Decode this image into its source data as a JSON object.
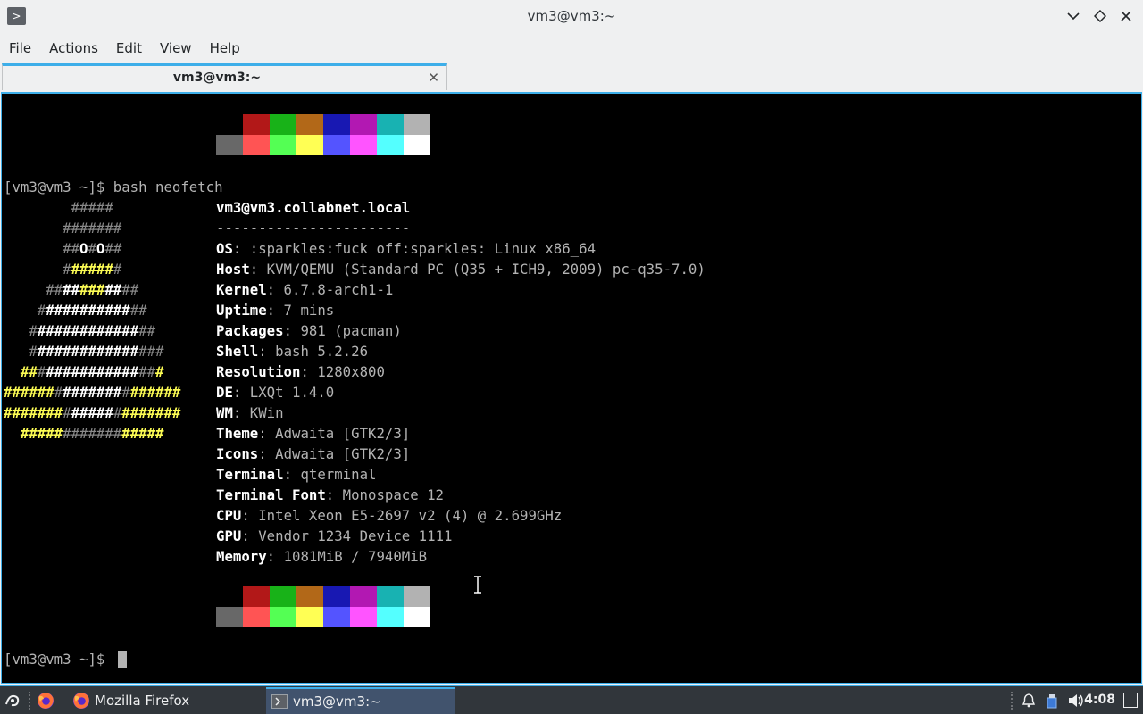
{
  "window": {
    "title": "vm3@vm3:~",
    "app_icon_glyph": ">"
  },
  "menubar": [
    "File",
    "Actions",
    "Edit",
    "View",
    "Help"
  ],
  "tab": {
    "label": "vm3@vm3:~",
    "close_glyph": "✕"
  },
  "terminal": {
    "command_line": "[vm3@vm3 ~]$ bash neofetch",
    "prompt_line": "[vm3@vm3 ~]$ ",
    "user_host": "vm3@vm3.collabnet.local",
    "separator": "-----------------------",
    "info": [
      {
        "key": "OS",
        "value": ": :sparkles:fuck off:sparkles: Linux x86_64"
      },
      {
        "key": "Host",
        "value": ": KVM/QEMU (Standard PC (Q35 + ICH9, 2009) pc-q35-7.0)"
      },
      {
        "key": "Kernel",
        "value": ": 6.7.8-arch1-1"
      },
      {
        "key": "Uptime",
        "value": ": 7 mins"
      },
      {
        "key": "Packages",
        "value": ": 981 (pacman)"
      },
      {
        "key": "Shell",
        "value": ": bash 5.2.26"
      },
      {
        "key": "Resolution",
        "value": ": 1280x800"
      },
      {
        "key": "DE",
        "value": ": LXQt 1.4.0"
      },
      {
        "key": "WM",
        "value": ": KWin"
      },
      {
        "key": "Theme",
        "value": ": Adwaita [GTK2/3]"
      },
      {
        "key": "Icons",
        "value": ": Adwaita [GTK2/3]"
      },
      {
        "key": "Terminal",
        "value": ": qterminal"
      },
      {
        "key": "Terminal Font",
        "value": ": Monospace 12"
      },
      {
        "key": "CPU",
        "value": ": Intel Xeon E5-2697 v2 (4) @ 2.699GHz"
      },
      {
        "key": "GPU",
        "value": ": Vendor 1234 Device 1111"
      },
      {
        "key": "Memory",
        "value": ": 1081MiB / 7940MiB"
      }
    ],
    "ascii_logo": [
      [
        [
          "gry",
          "        #####"
        ]
      ],
      [
        [
          "gry",
          "       #######"
        ]
      ],
      [
        [
          "gry",
          "       ##"
        ],
        [
          "wht",
          "O"
        ],
        [
          "gry",
          "#"
        ],
        [
          "wht",
          "O"
        ],
        [
          "gry",
          "##"
        ]
      ],
      [
        [
          "gry",
          "       #"
        ],
        [
          "ylw",
          "#####"
        ],
        [
          "gry",
          "#"
        ]
      ],
      [
        [
          "gry",
          "     ##"
        ],
        [
          "wht",
          "##"
        ],
        [
          "ylw",
          "###"
        ],
        [
          "wht",
          "##"
        ],
        [
          "gry",
          "##"
        ]
      ],
      [
        [
          "gry",
          "    #"
        ],
        [
          "wht",
          "##########"
        ],
        [
          "gry",
          "##"
        ]
      ],
      [
        [
          "gry",
          "   #"
        ],
        [
          "wht",
          "############"
        ],
        [
          "gry",
          "##"
        ]
      ],
      [
        [
          "gry",
          "   #"
        ],
        [
          "wht",
          "############"
        ],
        [
          "gry",
          "###"
        ]
      ],
      [
        [
          "ylw",
          "  ##"
        ],
        [
          "gry",
          "#"
        ],
        [
          "wht",
          "###########"
        ],
        [
          "gry",
          "##"
        ],
        [
          "ylw",
          "#"
        ]
      ],
      [
        [
          "ylw",
          "######"
        ],
        [
          "gry",
          "#"
        ],
        [
          "wht",
          "#######"
        ],
        [
          "gry",
          "#"
        ],
        [
          "ylw",
          "######"
        ]
      ],
      [
        [
          "ylw",
          "#######"
        ],
        [
          "gry",
          "#"
        ],
        [
          "wht",
          "#####"
        ],
        [
          "gry",
          "#"
        ],
        [
          "ylw",
          "#######"
        ]
      ],
      [
        [
          "ylw",
          "  #####"
        ],
        [
          "gry",
          "#######"
        ],
        [
          "ylw",
          "#####"
        ]
      ]
    ],
    "palette_top": [
      "#000000",
      "#b21818",
      "#18b218",
      "#b26818",
      "#1818b2",
      "#b218b2",
      "#18b2b2",
      "#b2b2b2"
    ],
    "palette_bottom": [
      "#686868",
      "#ff5454",
      "#54ff54",
      "#ffff54",
      "#5454ff",
      "#ff54ff",
      "#54ffff",
      "#ffffff"
    ]
  },
  "taskbar": {
    "firefox_label": "Mozilla Firefox",
    "terminal_label": "vm3@vm3:~",
    "clock": "4:08"
  },
  "colors": {
    "accent": "#3daee9",
    "taskbar_bg": "#31363b"
  }
}
